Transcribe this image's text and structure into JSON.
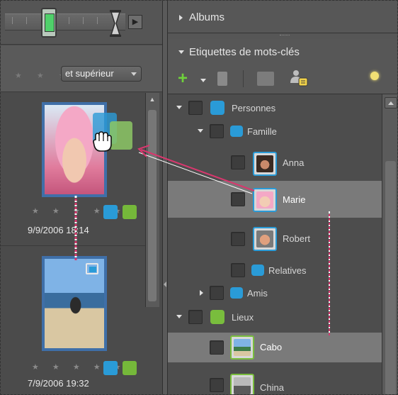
{
  "colors": {
    "panel_bg": "#4b4b4b",
    "selection_bg": "#7a7a7a",
    "people_tag": "#2a9bd7",
    "places_tag": "#79bd3d",
    "add_icon": "#6fd23b",
    "drag_arrow": "#d9376e"
  },
  "timeline": {
    "slider_icon": "timeline-slider-thumb",
    "next_label": "▶"
  },
  "filter": {
    "stars_label": "★ ★ ★",
    "rating_option": "et supérieur"
  },
  "grid": {
    "items": [
      {
        "stars": "★ ★ ★ ★ ★",
        "date": "9/9/2006 18:14"
      },
      {
        "stars": "★ ★ ★ ★ ★",
        "date": "7/9/2006 19:32"
      }
    ]
  },
  "panels": {
    "albums": "Albums",
    "keyword_tags": "Etiquettes de mots-clés"
  },
  "tree": {
    "personnes": "Personnes",
    "famille": "Famille",
    "anna": "Anna",
    "marie": "Marie",
    "robert": "Robert",
    "relatives": "Relatives",
    "amis": "Amis",
    "lieux": "Lieux",
    "cabo": "Cabo",
    "china": "China"
  }
}
